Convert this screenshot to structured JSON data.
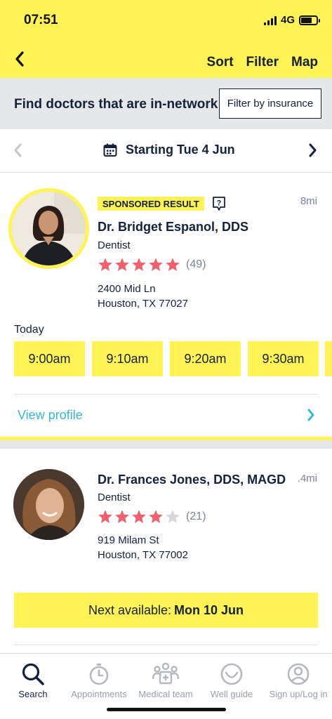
{
  "status_bar": {
    "time": "07:51",
    "network": "4G"
  },
  "header": {
    "actions": [
      {
        "label": "Sort"
      },
      {
        "label": "Filter"
      },
      {
        "label": "Map"
      }
    ]
  },
  "network_banner": {
    "title": "Find doctors that are in-network",
    "button_label": "Filter by insurance"
  },
  "date_nav": {
    "label": "Starting Tue 4 Jun"
  },
  "results": [
    {
      "badge": "SPONSORED RESULT",
      "distance": "8mi",
      "name": "Dr. Bridget Espanol, DDS",
      "specialty": "Dentist",
      "rating": 5,
      "reviews": "(49)",
      "address_line1": "2400 Mid Ln",
      "address_line2": "Houston, TX 77027",
      "day_label": "Today",
      "slots": [
        "9:00am",
        "9:10am",
        "9:20am",
        "9:30am"
      ],
      "view_profile": "View profile"
    },
    {
      "distance": ".4mi",
      "name": "Dr. Frances Jones, DDS, MAGD",
      "specialty": "Dentist",
      "rating": 4,
      "reviews": "(21)",
      "address_line1": "919 Milam St",
      "address_line2": "Houston, TX 77002",
      "next_available_prefix": "Next available:",
      "next_available_date": "Mon 10 Jun"
    }
  ],
  "tabs": [
    {
      "label": "Search",
      "icon": "search-icon",
      "active": true
    },
    {
      "label": "Appointments",
      "icon": "stopwatch-icon",
      "active": false
    },
    {
      "label": "Medical team",
      "icon": "team-icon",
      "active": false
    },
    {
      "label": "Well guide",
      "icon": "smile-icon",
      "active": false
    },
    {
      "label": "Sign up/Log in",
      "icon": "user-icon",
      "active": false
    }
  ],
  "colors": {
    "brand_yellow": "#fff355",
    "navy": "#14213d",
    "star": "#f0606d",
    "star_empty": "#d6d6d6",
    "link": "#35b8d6",
    "muted": "#7b8293"
  }
}
